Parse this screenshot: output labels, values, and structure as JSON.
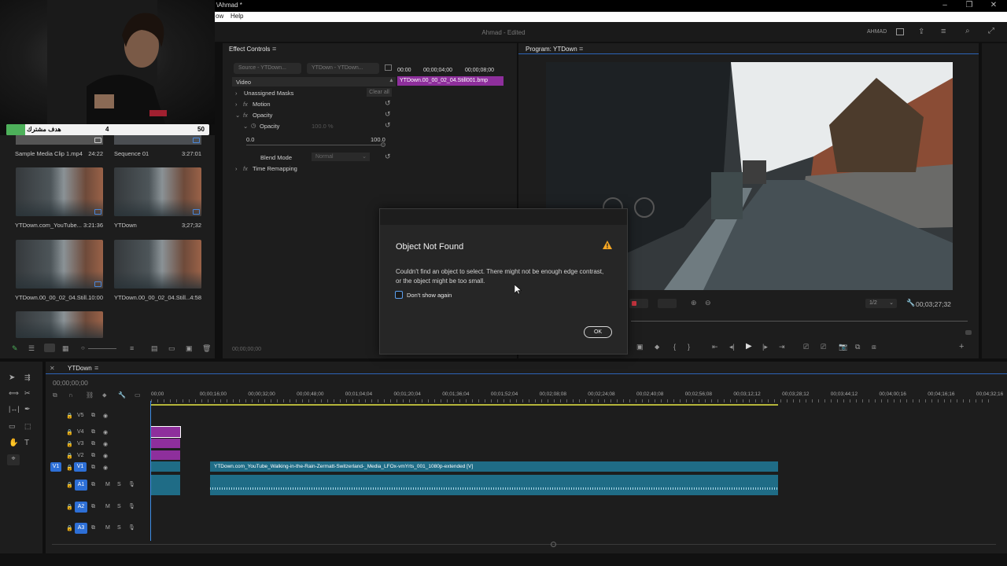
{
  "window": {
    "title": "\\Ahmad *",
    "project_name": "Ahmad - Edited",
    "user": "AHMAD"
  },
  "menu": [
    "ow",
    "Help"
  ],
  "overlay": {
    "label": "هدف مشترك",
    "count": "4",
    "target": "50"
  },
  "project_panel": {
    "items": [
      {
        "name": "Sample Media Clip 1.mp4",
        "duration": "24:22"
      },
      {
        "name": "Sequence 01",
        "duration": "3:27:01"
      },
      {
        "name": "YTDown.com_YouTube...",
        "duration": "3:21:36"
      },
      {
        "name": "YTDown",
        "duration": "3;27;32"
      },
      {
        "name": "YTDown.00_00_02_04.Still...",
        "duration": "10:00"
      },
      {
        "name": "YTDown.00_00_02_04.Still...",
        "duration": "4:58"
      }
    ]
  },
  "effect_controls": {
    "title": "Effect Controls",
    "source_label": "Source - YTDown...",
    "sequence_label": "YTDown - YTDown...",
    "ruler": [
      "00:00",
      "00;00;04;00",
      "00;00;08;00"
    ],
    "clip_label": "YTDown.00_00_02_04.Still001.bmp",
    "video_header": "Video",
    "unassigned_masks": "Unassigned Masks",
    "clear_all": "Clear all",
    "motion": "Motion",
    "opacity": "Opacity",
    "opacity_sub": "Opacity",
    "opacity_value": "100.0 %",
    "range_min": "0.0",
    "range_max": "100.0",
    "blend_mode_label": "Blend Mode",
    "blend_mode_value": "Normal",
    "time_remapping": "Time Remapping",
    "timecode": "00;00;00;00"
  },
  "program": {
    "title": "Program: YTDown",
    "zoom": "1/2",
    "timecode": "00;03;27;32"
  },
  "timeline": {
    "sequence_name": "YTDown",
    "timecode": "00;00;00;00",
    "ruler": [
      "00;00",
      "00;00;16;00",
      "00;00;32;00",
      "00;00;48;00",
      "00;01;04;04",
      "00;01;20;04",
      "00;01;36;04",
      "00;01;52;04",
      "00;02;08;08",
      "00;02;24;08",
      "00;02;40;08",
      "00;02;56;08",
      "00;03;12;12",
      "00;03;28;12",
      "00;03;44;12",
      "00;04;00;16",
      "00;04;16;16",
      "00;04;32;16"
    ],
    "video_tracks": [
      "V5",
      "V4",
      "V3",
      "V2",
      "V1"
    ],
    "audio_tracks": [
      "A1",
      "A2",
      "A3"
    ],
    "source_patch_video": "V1",
    "main_clip": "YTDown.com_YouTube_Walking-in-the-Rain-Zermatt-Switzerland-_Media_LFOx-vmYrts_001_1080p-extended [V]",
    "track_flags": [
      "M",
      "S"
    ]
  },
  "dialog": {
    "title": "Object Not Found",
    "message": "Couldn't find an object to select. There might not be enough edge contrast, or the object might be too small.",
    "checkbox_label": "Don't show again",
    "ok_label": "OK",
    "warning_color": "#f5a623"
  },
  "colors": {
    "accent_blue": "#2d6fd6",
    "clip_purple": "#8e2f9c",
    "clip_teal": "#1f6c86",
    "playhead": "#3e8ee6"
  }
}
